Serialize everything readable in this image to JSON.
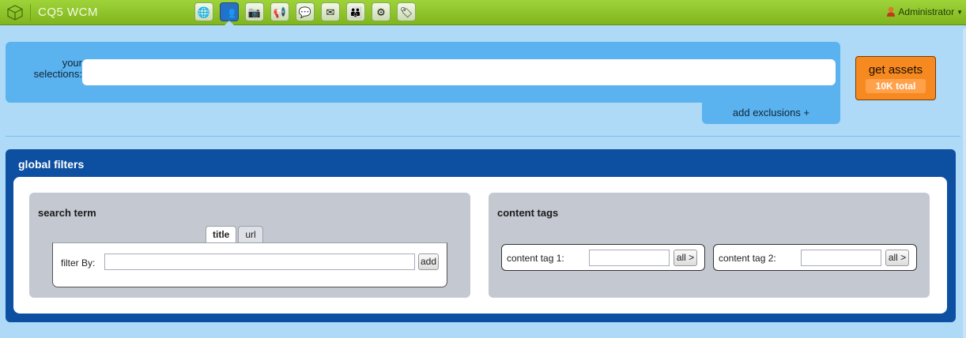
{
  "topbar": {
    "brand": "CQ5 WCM",
    "user": "Administrator",
    "tools": [
      "globe-icon",
      "people-icon",
      "camera-icon",
      "megaphone-icon",
      "chat-icon",
      "mail-icon",
      "users-icon",
      "gear-icon",
      "tag-icon"
    ],
    "active_tool": "people-icon",
    "brand_color": "#8cc42a"
  },
  "selections": {
    "label": "your selections:",
    "value": "",
    "exclusions_label": "add exclusions +"
  },
  "get_assets": {
    "label": "get assets",
    "total": "10K total",
    "color": "#f6891f"
  },
  "global_filters": {
    "title": "global filters",
    "search_term": {
      "title": "search term",
      "tabs": [
        "title",
        "url"
      ],
      "active_tab": "title",
      "filter_label": "filter By:",
      "filter_value": "",
      "add_label": "add"
    },
    "content_tags": {
      "title": "content tags",
      "tags": [
        {
          "label": "content tag 1:",
          "value": "",
          "button": "all >"
        },
        {
          "label": "content tag 2:",
          "value": "",
          "button": "all >"
        }
      ]
    },
    "color": "#0d4fa1"
  }
}
